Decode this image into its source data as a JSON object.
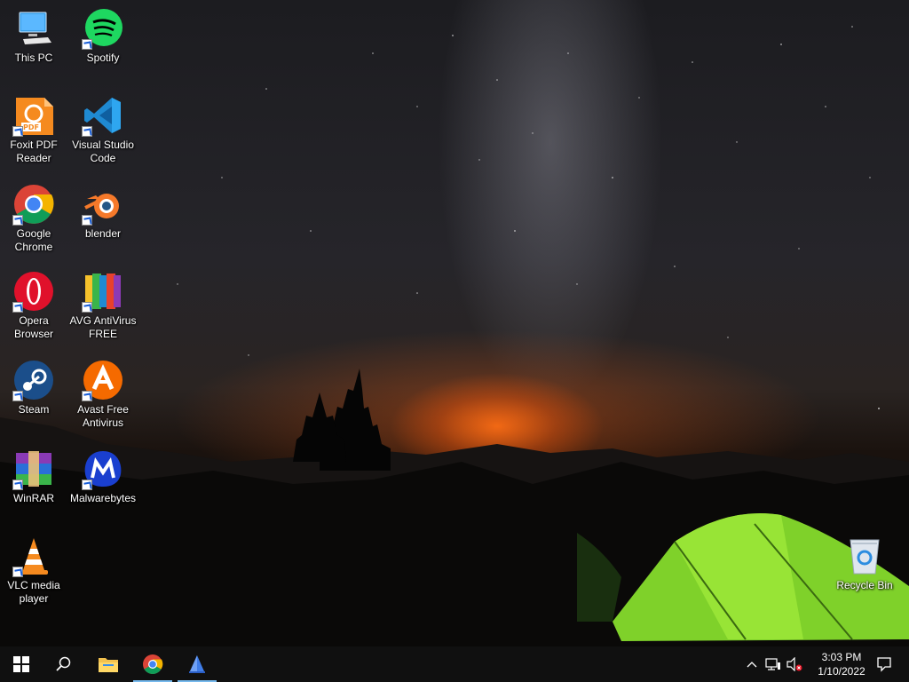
{
  "desktop": {
    "icons": [
      {
        "label": "This PC"
      },
      {
        "label": "Spotify"
      },
      {
        "label": "Foxit PDF Reader"
      },
      {
        "label": "Visual Studio Code"
      },
      {
        "label": "Google Chrome"
      },
      {
        "label": "blender"
      },
      {
        "label": "Opera Browser"
      },
      {
        "label": "AVG AntiVirus FREE"
      },
      {
        "label": "Steam"
      },
      {
        "label": "Avast Free Antivirus"
      },
      {
        "label": "WinRAR"
      },
      {
        "label": "Malwarebytes"
      },
      {
        "label": "VLC media player"
      },
      {
        "label": "Recycle Bin"
      }
    ]
  },
  "taskbar": {
    "time": "3:03 PM",
    "date": "1/10/2022"
  }
}
